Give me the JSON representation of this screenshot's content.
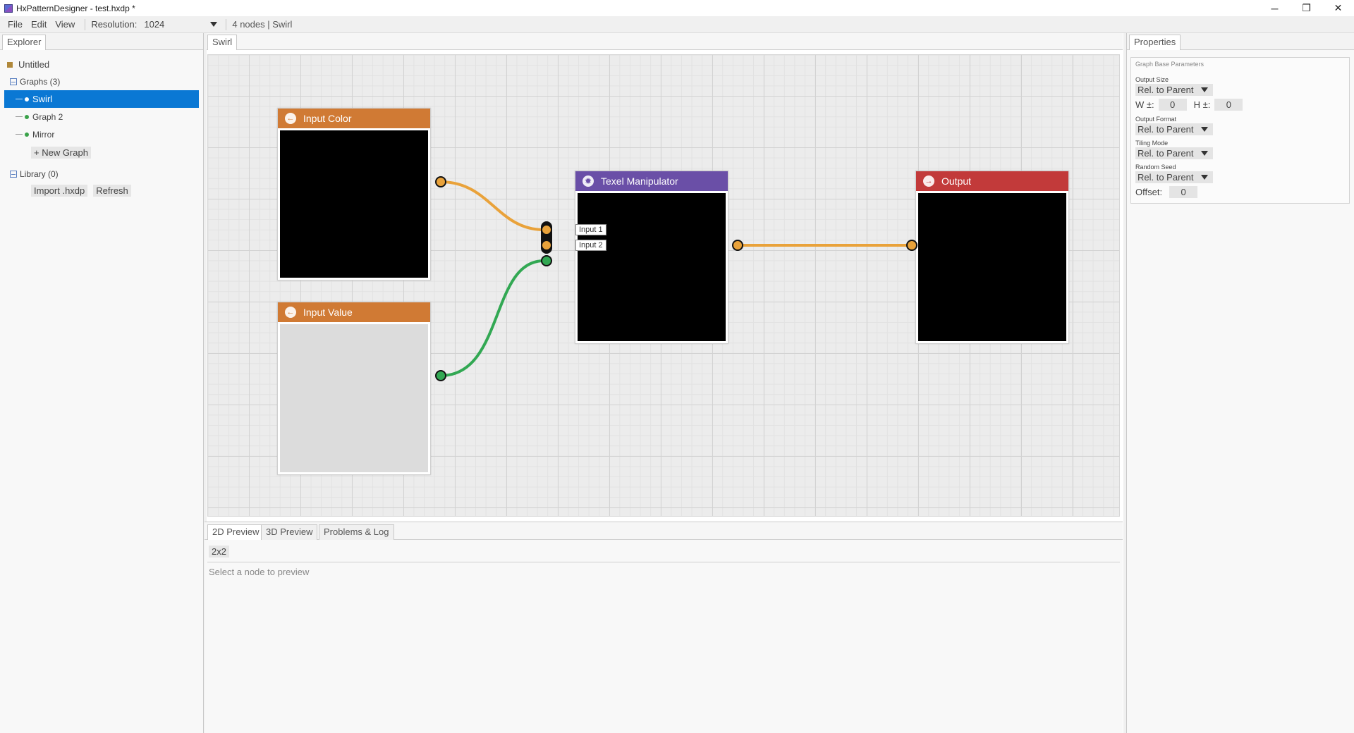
{
  "window": {
    "title": "HxPatternDesigner - test.hxdp *",
    "minimize": "─",
    "restore": "❐",
    "close": "✕"
  },
  "menubar": {
    "file": "File",
    "edit": "Edit",
    "view": "View",
    "resolution_label": "Resolution:",
    "resolution_value": "1024",
    "status": "4 nodes | Swirl"
  },
  "explorer": {
    "tab": "Explorer",
    "project": "Untitled",
    "graphs_label": "Graphs (3)",
    "graphs": [
      "Swirl",
      "Graph 2",
      "Mirror"
    ],
    "new_graph": "+ New Graph",
    "library_label": "Library (0)",
    "import_button": "Import .hxdp",
    "refresh_button": "Refresh"
  },
  "graph_tab": "Swirl",
  "nodes": {
    "input_color": {
      "title": "Input Color",
      "color": "#d07a34"
    },
    "input_value": {
      "title": "Input Value",
      "color": "#d07a34"
    },
    "texel": {
      "title": "Texel Manipulator",
      "color": "#6a4fa7",
      "input1": "Input 1",
      "input2": "Input 2"
    },
    "output": {
      "title": "Output",
      "color": "#c23a3a"
    }
  },
  "wire_colors": {
    "image": "#e9a23a",
    "value": "#32a853"
  },
  "properties": {
    "tab": "Properties",
    "legend": "Graph Base Parameters",
    "output_size_label": "Output Size",
    "output_size_value": "Rel. to Parent",
    "w_label": "W ±:",
    "w_value": "0",
    "h_label": "H ±:",
    "h_value": "0",
    "output_format_label": "Output Format",
    "output_format_value": "Rel. to Parent",
    "tiling_mode_label": "Tiling Mode",
    "tiling_mode_value": "Rel. to Parent",
    "random_seed_label": "Random Seed",
    "random_seed_value": "Rel. to Parent",
    "offset_label": "Offset:",
    "offset_value": "0"
  },
  "preview": {
    "tabs": [
      "2D Preview",
      "3D Preview",
      "Problems & Log"
    ],
    "size_button": "2x2",
    "hint": "Select a node to preview"
  }
}
